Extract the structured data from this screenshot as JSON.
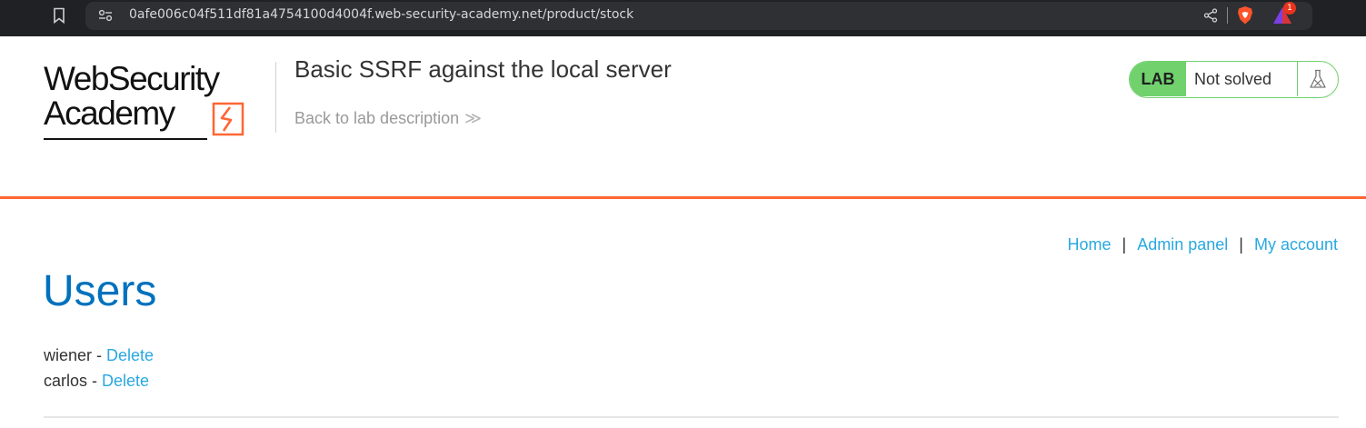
{
  "browser": {
    "url": "0afe006c04f511df81a4754100d4004f.web-security-academy.net/product/stock",
    "rewards_badge": "1"
  },
  "header": {
    "logo_line1": "WebSecurity",
    "logo_line2": "Academy",
    "lab_title": "Basic SSRF against the local server",
    "back_link": "Back to lab description",
    "back_chevrons": "≫",
    "lab_badge": "LAB",
    "lab_status": "Not solved"
  },
  "nav": {
    "home": "Home",
    "separator": "|",
    "admin_panel": "Admin panel",
    "my_account": "My account"
  },
  "main": {
    "title": "Users",
    "users": [
      {
        "name": "wiener",
        "separator": " - ",
        "action": "Delete"
      },
      {
        "name": "carlos",
        "separator": " - ",
        "action": "Delete"
      }
    ]
  },
  "colors": {
    "accent_orange": "#ff6633",
    "title_blue": "#0071bc",
    "link_blue": "#29a8e0",
    "lab_green": "#70d16d",
    "browser_dark": "#202124"
  }
}
